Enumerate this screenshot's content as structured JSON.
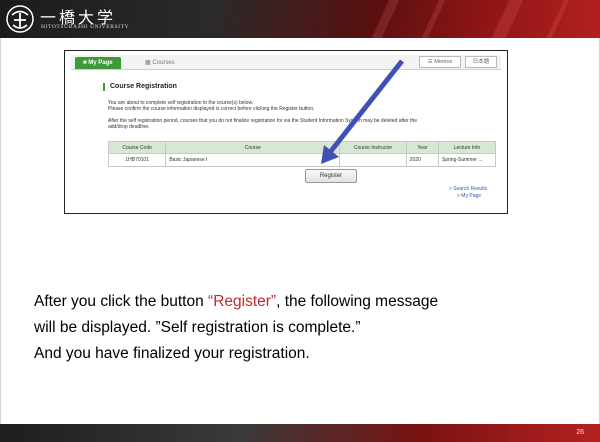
{
  "logo": {
    "kanji": "一橋大学",
    "subtitle": "HITOTSUBASHI UNIVERSITY"
  },
  "portal": {
    "tabs": {
      "my_page": "My Page",
      "courses": "Courses"
    },
    "buttons": {
      "memos": "Memos",
      "language": "日本語"
    },
    "title": "Course Registration",
    "instructions": [
      "You are about to complete self registration to the course(s) below.",
      "Please confirm the course information displayed is correct before clicking the Register button.",
      "After the self registration period, courses that you do not finalize registration for via the Student Information System may be deleted after the",
      "add/drop deadline."
    ],
    "table": {
      "headers": [
        "Course Code",
        "Course",
        "Course Instructor",
        "Year",
        "Lecture Info"
      ],
      "rows": [
        [
          "1HB70101",
          "Basic Japanese I",
          "",
          "2020",
          "Spring-Summer ..."
        ]
      ]
    },
    "register_label": "Register",
    "links": {
      "search_results": "> Search Results",
      "my_page": "> My Page"
    }
  },
  "caption": {
    "line1_pre": "After you click the button ",
    "line1_highlight": "“Register”",
    "line1_post": ", the following message",
    "line2": "will be displayed. ”Self registration is complete.”",
    "line3": "And you have finalized your registration."
  },
  "page_number": "26",
  "colors": {
    "accent_green": "#3d9a36",
    "highlight_red": "#c0282d",
    "arrow_blue": "#3f51b5"
  }
}
